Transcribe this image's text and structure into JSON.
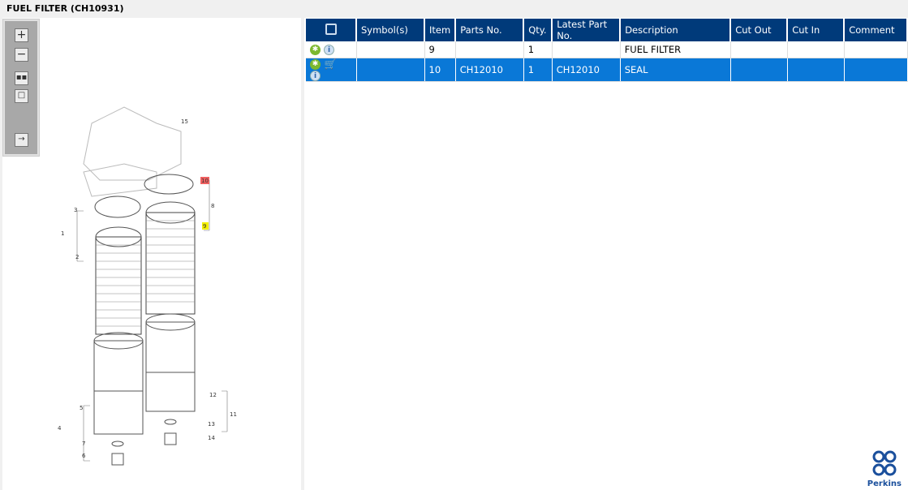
{
  "title": "FUEL FILTER (CH10931)",
  "toolbar": {
    "icons": [
      "zoom-in-icon",
      "zoom-out-icon",
      "fit-icon",
      "actual-size-icon",
      "expand-panel-icon"
    ]
  },
  "table": {
    "headers": [
      "",
      "Symbol(s)",
      "Item",
      "Parts No.",
      "Qty.",
      "Latest Part No.",
      "Description",
      "Cut Out",
      "Cut In",
      "Comment"
    ],
    "rows": [
      {
        "item": "9",
        "parts_no": "",
        "qty": "1",
        "latest": "",
        "description": "FUEL FILTER",
        "cut_out": "",
        "cut_in": "",
        "comment": "",
        "selected": false
      },
      {
        "item": "10",
        "parts_no": "CH12010",
        "qty": "1",
        "latest": "CH12010",
        "description": "SEAL",
        "cut_out": "",
        "cut_in": "",
        "comment": "",
        "selected": true
      }
    ]
  },
  "diagram": {
    "callouts": [
      "1",
      "2",
      "3",
      "4",
      "5",
      "6",
      "7",
      "8",
      "9",
      "10",
      "11",
      "12",
      "13",
      "14",
      "15"
    ],
    "highlight_selected": "#f06060",
    "highlight_other": "#f4f000"
  },
  "brand": "Perkins"
}
